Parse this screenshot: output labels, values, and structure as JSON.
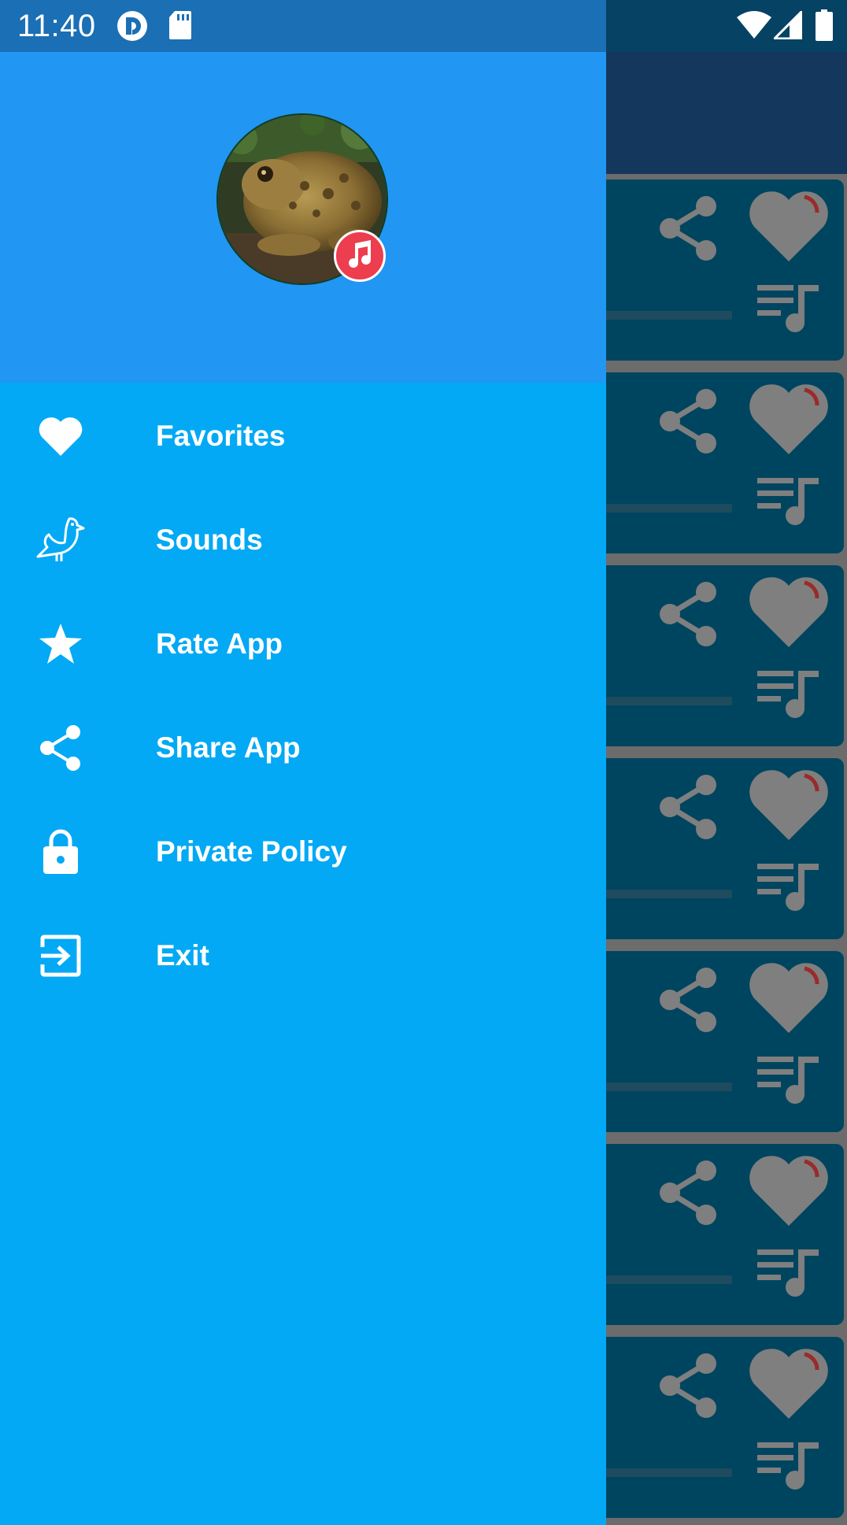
{
  "status_bar": {
    "time": "11:40",
    "icons": [
      "pocket-casts-icon",
      "sd-card-icon",
      "wifi-icon",
      "cell-signal-icon",
      "battery-icon"
    ]
  },
  "drawer": {
    "header": {
      "avatar": "toad-photo",
      "badge": "music-note-icon"
    },
    "items": [
      {
        "label": "Favorites",
        "icon": "heart-icon"
      },
      {
        "label": "Sounds",
        "icon": "bird-icon"
      },
      {
        "label": "Rate App",
        "icon": "star-icon"
      },
      {
        "label": "Share App",
        "icon": "share-icon"
      },
      {
        "label": "Private Policy",
        "icon": "lock-icon"
      },
      {
        "label": "Exit",
        "icon": "exit-icon"
      }
    ]
  },
  "background_list": {
    "card_icons": [
      "share-icon",
      "heart-icon",
      "playlist-icon"
    ],
    "card_count": 7
  },
  "colors": {
    "drawer_bg": "#03a9f4",
    "header_bg": "#2196f3",
    "status_bar_bg": "#1b6fb4",
    "badge": "#ec3e4e"
  }
}
